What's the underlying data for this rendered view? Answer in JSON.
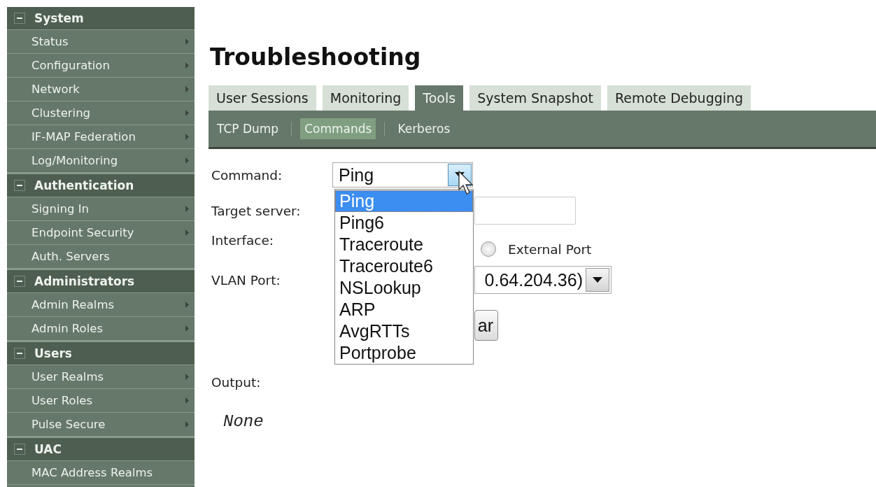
{
  "sidebar": {
    "sections": [
      {
        "title": "System",
        "expanded": true,
        "items": [
          {
            "label": "Status",
            "submenu": true
          },
          {
            "label": "Configuration",
            "submenu": true
          },
          {
            "label": "Network",
            "submenu": true
          },
          {
            "label": "Clustering",
            "submenu": true
          },
          {
            "label": "IF-MAP Federation",
            "submenu": true
          },
          {
            "label": "Log/Monitoring",
            "submenu": true
          }
        ]
      },
      {
        "title": "Authentication",
        "expanded": true,
        "items": [
          {
            "label": "Signing In",
            "submenu": true
          },
          {
            "label": "Endpoint Security",
            "submenu": true
          },
          {
            "label": "Auth. Servers",
            "submenu": false
          }
        ]
      },
      {
        "title": "Administrators",
        "expanded": true,
        "items": [
          {
            "label": "Admin Realms",
            "submenu": true
          },
          {
            "label": "Admin Roles",
            "submenu": true
          }
        ]
      },
      {
        "title": "Users",
        "expanded": true,
        "items": [
          {
            "label": "User Realms",
            "submenu": true
          },
          {
            "label": "User Roles",
            "submenu": true
          },
          {
            "label": "Pulse Secure",
            "submenu": true
          }
        ]
      },
      {
        "title": "UAC",
        "expanded": true,
        "items": [
          {
            "label": "MAC Address Realms",
            "submenu": false
          }
        ]
      }
    ]
  },
  "page_title": "Troubleshooting",
  "tabs": [
    {
      "label": "User Sessions",
      "selected": false
    },
    {
      "label": "Monitoring",
      "selected": false
    },
    {
      "label": "Tools",
      "selected": true
    },
    {
      "label": "System Snapshot",
      "selected": false
    },
    {
      "label": "Remote Debugging",
      "selected": false
    }
  ],
  "subtabs": [
    {
      "label": "TCP Dump",
      "selected": false
    },
    {
      "label": "Commands",
      "selected": true
    },
    {
      "label": "Kerberos",
      "selected": false
    }
  ],
  "form": {
    "command": {
      "label": "Command:",
      "value": "Ping",
      "options": [
        {
          "label": "Ping",
          "selected": true
        },
        {
          "label": "Ping6",
          "selected": false
        },
        {
          "label": "Traceroute",
          "selected": false
        },
        {
          "label": "Traceroute6",
          "selected": false
        },
        {
          "label": "NSLookup",
          "selected": false
        },
        {
          "label": "ARP",
          "selected": false
        },
        {
          "label": "AvgRTTs",
          "selected": false
        },
        {
          "label": "Portprobe",
          "selected": false
        }
      ]
    },
    "target_server": {
      "label": "Target server:"
    },
    "interface": {
      "label": "Interface:",
      "option": {
        "label": "External Port",
        "selected": false
      }
    },
    "vlan_port": {
      "label": "VLAN Port:",
      "value": "0.64.204.36)"
    },
    "button": "ar",
    "output": {
      "label": "Output:",
      "value": "None"
    }
  }
}
